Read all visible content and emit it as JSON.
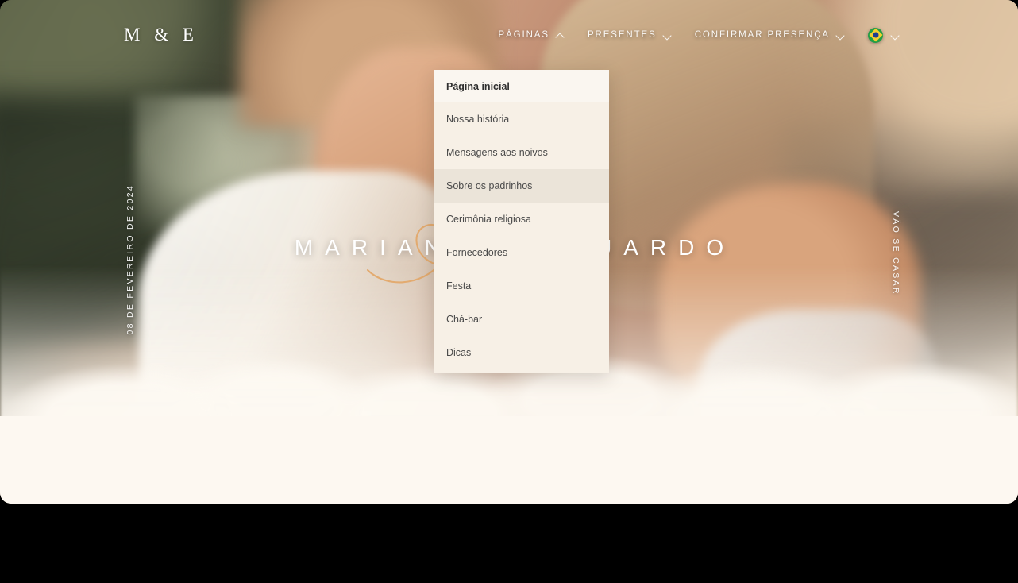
{
  "header": {
    "brand": "M & E",
    "nav": [
      {
        "label": "PÁGINAS",
        "icon": "chevron-up-icon",
        "expanded": true
      },
      {
        "label": "PRESENTES",
        "icon": "chevron-down-icon",
        "expanded": false
      },
      {
        "label": "CONFIRMAR PRESENÇA",
        "icon": "chevron-down-icon",
        "expanded": false
      }
    ],
    "language": {
      "icon": "brazil-flag-icon",
      "chevron": "chevron-down-icon"
    }
  },
  "hero": {
    "names_visible_left": "M A R I A N",
    "names_visible_right": "A R D O",
    "full_names": "MARIANA & EDUARDO",
    "ampersand_decoration": "gold-script-ampersand",
    "date_caption": "08 DE FEVEREIRO DE 2024",
    "side_caption": "VÃO SE CASAR"
  },
  "dropdown": {
    "owner": "PÁGINAS",
    "items": [
      {
        "label": "Página inicial",
        "state": "current"
      },
      {
        "label": "Nossa história",
        "state": "default"
      },
      {
        "label": "Mensagens aos noivos",
        "state": "default"
      },
      {
        "label": "Sobre os padrinhos",
        "state": "hover"
      },
      {
        "label": "Cerimônia religiosa",
        "state": "default"
      },
      {
        "label": "Fornecedores",
        "state": "default"
      },
      {
        "label": "Festa",
        "state": "default"
      },
      {
        "label": "Chá-bar",
        "state": "default"
      },
      {
        "label": "Dicas",
        "state": "default"
      }
    ]
  },
  "colors": {
    "menu_background": "#F7F0E6",
    "menu_current_background": "#FAF6F0",
    "menu_hover_background": "#EBE4D9",
    "menu_text": "#4a4a4a",
    "page_bottom_cream": "#FDF8F1",
    "accent_gold": "#E0A86B",
    "hero_text": "#FFFFFF"
  }
}
